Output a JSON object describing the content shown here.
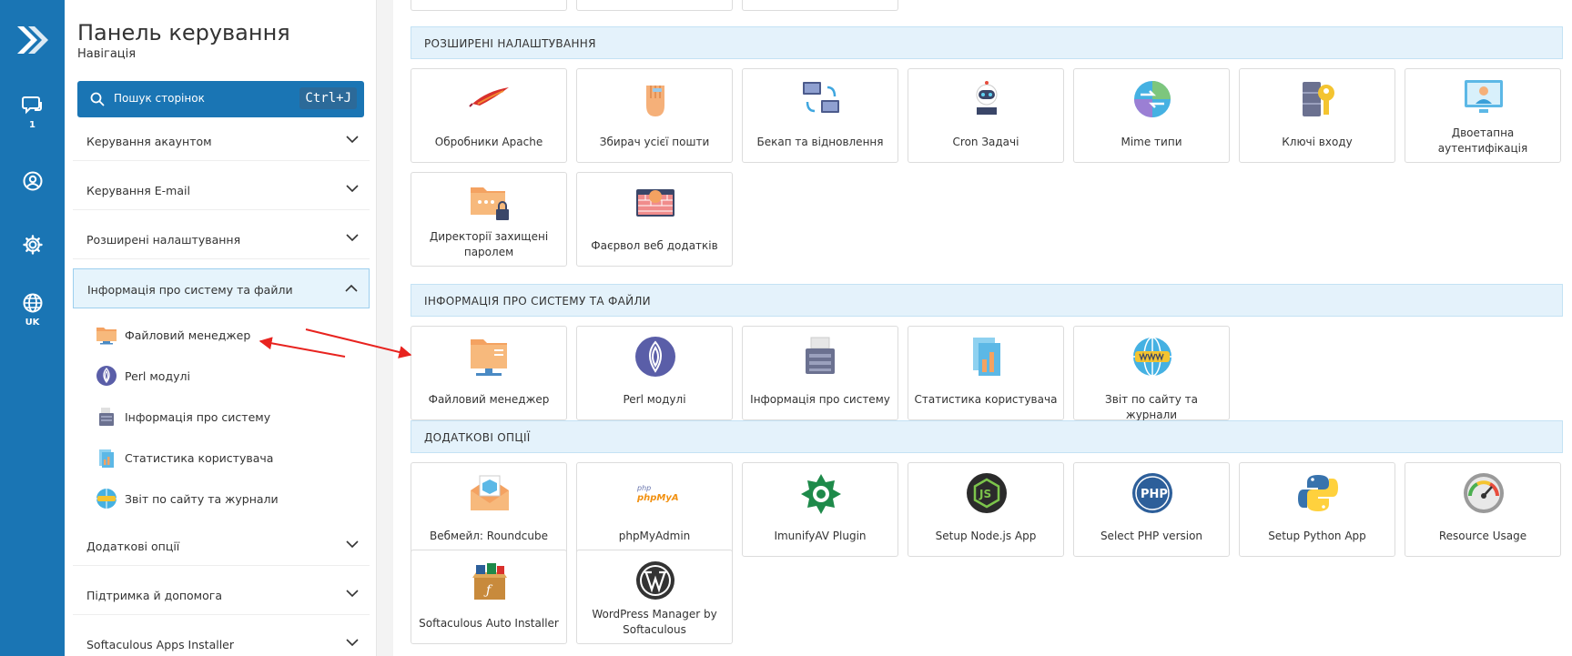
{
  "rail": {
    "chat_count": "1",
    "language": "UK"
  },
  "sidebar": {
    "title": "Панель керування",
    "subtitle": "Навігація",
    "search_placeholder": "Пошук сторінок",
    "search_shortcut": "Ctrl+J",
    "sections": [
      {
        "label": "Керування акаунтом",
        "expanded": false
      },
      {
        "label": "Керування E-mail",
        "expanded": false
      },
      {
        "label": "Розширені налаштування",
        "expanded": false
      },
      {
        "label": "Інформація про систему та файли",
        "expanded": true
      },
      {
        "label": "Додаткові опції",
        "expanded": false
      },
      {
        "label": "Підтримка й допомога",
        "expanded": false
      },
      {
        "label": "Softaculous Apps Installer",
        "expanded": false
      }
    ],
    "sub_items": [
      {
        "label": "Файловий менеджер",
        "icon": "folder-icon"
      },
      {
        "label": "Perl модулі",
        "icon": "perl-onion-icon"
      },
      {
        "label": "Інформація про систему",
        "icon": "server-icon"
      },
      {
        "label": "Статистика користувача",
        "icon": "stats-icon"
      },
      {
        "label": "Звіт по сайту та журнали",
        "icon": "www-globe-icon"
      }
    ]
  },
  "main": {
    "groups": [
      {
        "title": "РОЗШИРЕНІ НАЛАШТУВАННЯ",
        "tiles": [
          {
            "label": "Обробники Apache",
            "icon": "apache-feather-icon"
          },
          {
            "label": "Збирач усієї пошти",
            "icon": "hand-icon"
          },
          {
            "label": "Бекап та відновлення",
            "icon": "backup-icon"
          },
          {
            "label": "Cron Задачі",
            "icon": "robot-icon"
          },
          {
            "label": "Mime типи",
            "icon": "mime-icon"
          },
          {
            "label": "Ключі входу",
            "icon": "key-icon"
          },
          {
            "label": "Двоетапна аутентифікація",
            "icon": "two-factor-icon"
          },
          {
            "label": "Директорії захищені паролем",
            "icon": "locked-folder-icon"
          },
          {
            "label": "Фаєрвол веб додатків",
            "icon": "firewall-icon"
          }
        ]
      },
      {
        "title": "ІНФОРМАЦІЯ ПРО СИСТЕМУ ТА ФАЙЛИ",
        "tiles": [
          {
            "label": "Файловий менеджер",
            "icon": "folder-icon"
          },
          {
            "label": "Perl модулі",
            "icon": "perl-onion-icon"
          },
          {
            "label": "Інформація про систему",
            "icon": "server-icon"
          },
          {
            "label": "Статистика користувача",
            "icon": "stats-icon"
          },
          {
            "label": "Звіт по сайту та журнали",
            "icon": "www-globe-icon"
          }
        ]
      },
      {
        "title": "ДОДАТКОВІ ОПЦІЇ",
        "tiles": [
          {
            "label": "Вебмейл: Roundcube",
            "icon": "webmail-icon"
          },
          {
            "label": "phpMyAdmin",
            "icon": "phpmyadmin-icon",
            "logo_text": "phpMyAdmin"
          },
          {
            "label": "ImunifyAV Plugin",
            "icon": "imunify-icon"
          },
          {
            "label": "Setup Node.js App",
            "icon": "nodejs-icon",
            "logo_text": "JS"
          },
          {
            "label": "Select PHP version",
            "icon": "php-icon",
            "logo_text": "PHP"
          },
          {
            "label": "Setup Python App",
            "icon": "python-icon"
          },
          {
            "label": "Resource Usage",
            "icon": "gauge-icon"
          },
          {
            "label": "Softaculous Auto Installer",
            "icon": "softaculous-icon"
          },
          {
            "label": "WordPress Manager by Softaculous",
            "icon": "wordpress-icon"
          }
        ]
      }
    ]
  },
  "colors": {
    "brand": "#1a75b4",
    "group_header_bg": "#e4f2fb",
    "active_section_bg": "#e6f4fc",
    "arrow": "#e8231f"
  }
}
